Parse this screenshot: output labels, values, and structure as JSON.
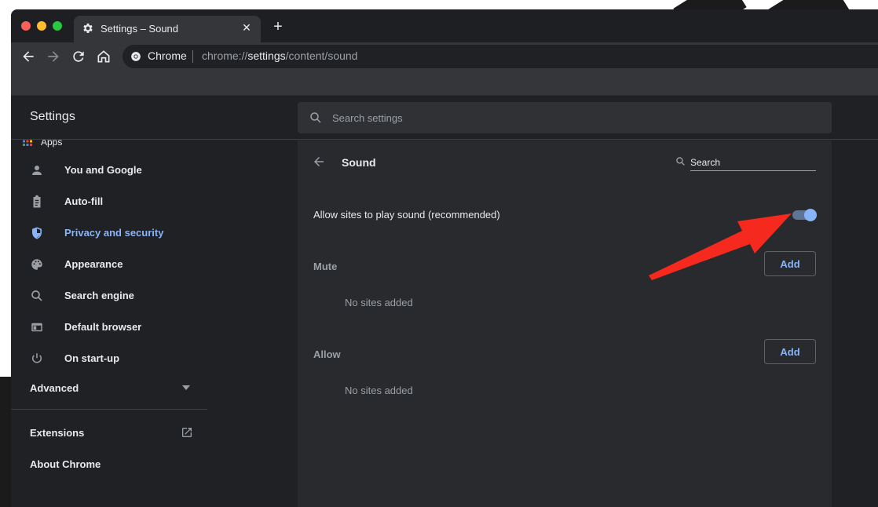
{
  "tab": {
    "title": "Settings – Sound",
    "close_glyph": "✕",
    "new_tab_glyph": "+"
  },
  "omnibox": {
    "site": "Chrome",
    "url_prefix": "chrome://",
    "url_bold": "settings",
    "url_suffix": "/content/sound"
  },
  "bookmarks": {
    "apps_label": "Apps"
  },
  "settings": {
    "title": "Settings",
    "search_placeholder": "Search settings"
  },
  "sidebar": {
    "items": [
      {
        "label": "You and Google",
        "icon": "person-icon"
      },
      {
        "label": "Auto-fill",
        "icon": "clipboard-icon"
      },
      {
        "label": "Privacy and security",
        "icon": "shield-icon",
        "active": true
      },
      {
        "label": "Appearance",
        "icon": "palette-icon"
      },
      {
        "label": "Search engine",
        "icon": "search-icon"
      },
      {
        "label": "Default browser",
        "icon": "browser-icon"
      },
      {
        "label": "On start-up",
        "icon": "power-icon"
      }
    ],
    "advanced": "Advanced",
    "extensions": "Extensions",
    "about": "About Chrome"
  },
  "card": {
    "title": "Sound",
    "search_placeholder": "Search",
    "allow_label": "Allow sites to play sound (recommended)",
    "allow_enabled": true,
    "mute": {
      "label": "Mute",
      "button": "Add",
      "empty": "No sites added"
    },
    "allow": {
      "label": "Allow",
      "button": "Add",
      "empty": "No sites added"
    }
  },
  "colors": {
    "accent": "#8ab4f8",
    "annotation": "#f5291d",
    "background": "#202124"
  }
}
